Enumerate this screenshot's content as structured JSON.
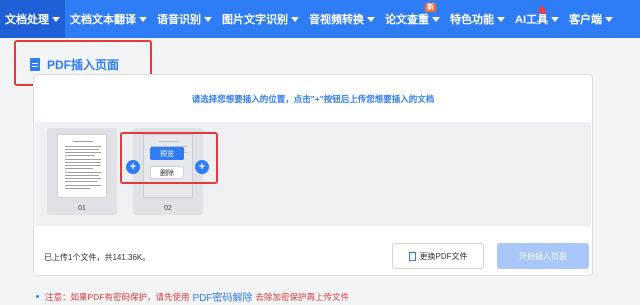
{
  "nav": {
    "items": [
      {
        "label": "文档处理",
        "active": true
      },
      {
        "label": "文档文本翻译"
      },
      {
        "label": "语音识别"
      },
      {
        "label": "图片文字识别"
      },
      {
        "label": "音视频转换"
      },
      {
        "label": "论文查重",
        "badge": "新"
      },
      {
        "label": "特色功能"
      },
      {
        "label": "AI工具"
      },
      {
        "label": "客户端"
      }
    ]
  },
  "page": {
    "title": "PDF插入页面",
    "instruction": "请选择您想要插入的位置，点击\"+\"按钮后上传您想要插入的文档"
  },
  "pages": [
    {
      "number": "01"
    },
    {
      "number": "02",
      "preview_label": "预览",
      "delete_label": "删除"
    }
  ],
  "footer": {
    "status": "已上传1个文件，共141.36K。",
    "replace_label": "更换PDF文件",
    "start_label": "开始插入页面"
  },
  "notice": {
    "prefix": "注意：如果PDF有密码保护，请先使用",
    "link": "PDF密码解除",
    "suffix": "去除加密保护再上传文件"
  },
  "colors": {
    "accent": "#2f7df6",
    "highlight": "#e23b3b",
    "disabled": "#a9c7f8"
  }
}
